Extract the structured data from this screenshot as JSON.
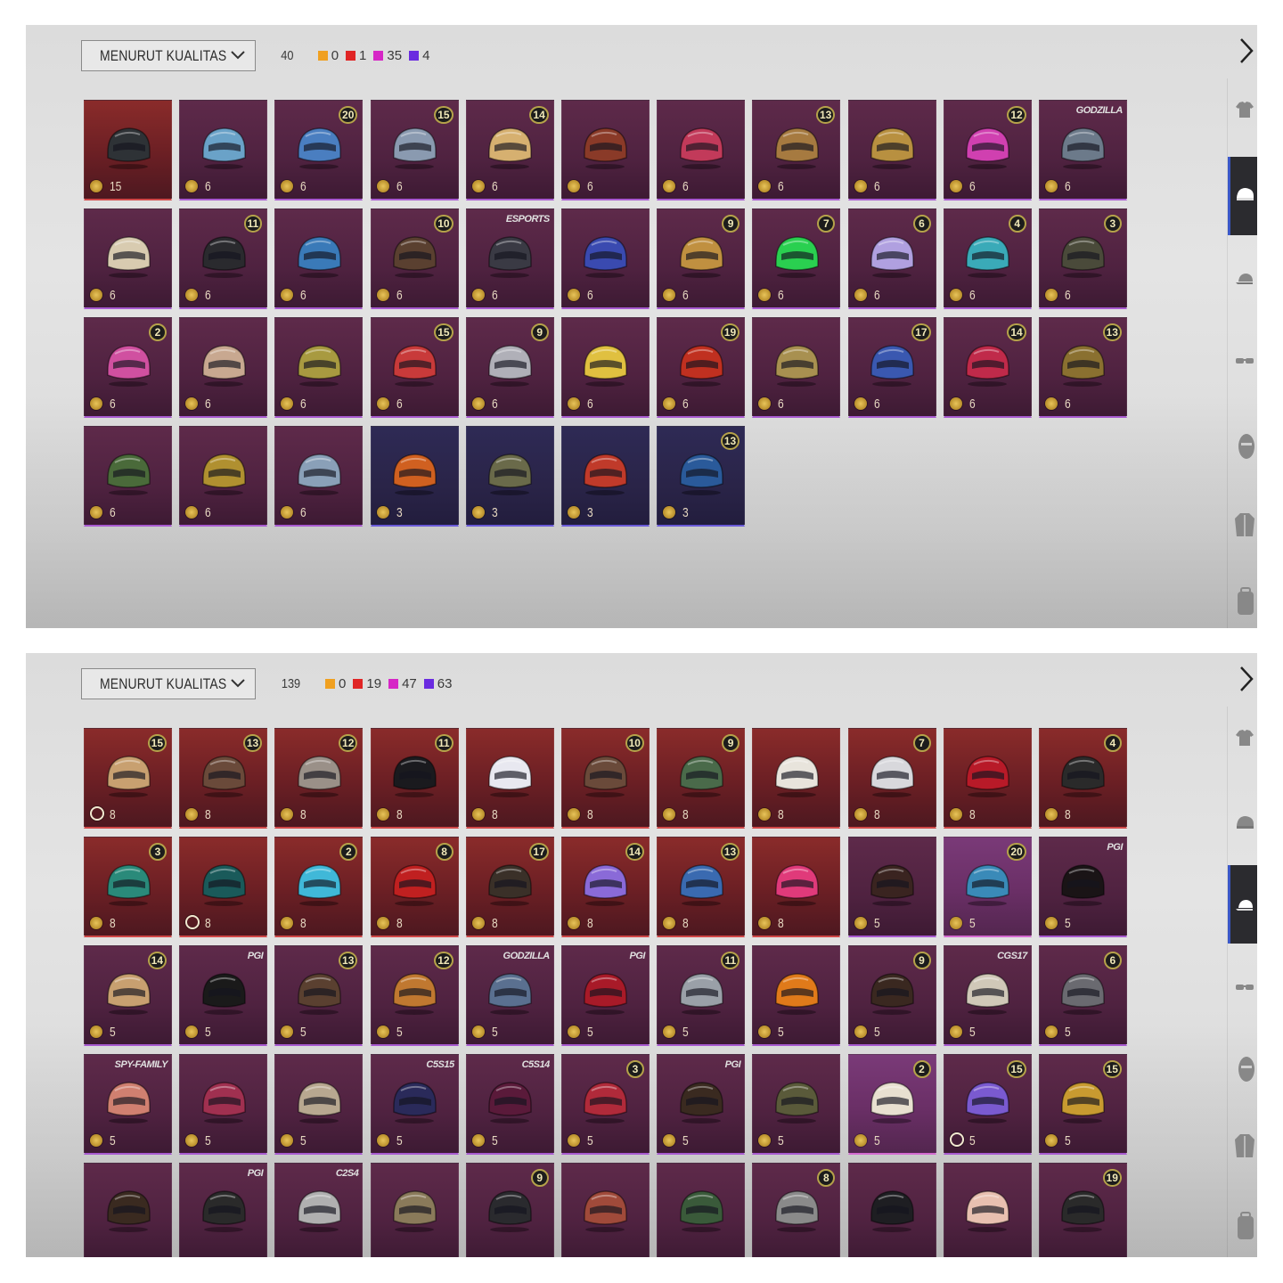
{
  "colors": {
    "orange": "#f0a020",
    "red": "#e02525",
    "pink": "#d626c6",
    "purple": "#6a2be0"
  },
  "panel_top": {
    "sort_label": "MENURUT KUALITAS",
    "total": "40",
    "counts": [
      {
        "color": "#f0a020",
        "value": "0"
      },
      {
        "color": "#e02525",
        "value": "1"
      },
      {
        "color": "#d626c6",
        "value": "35"
      },
      {
        "color": "#6a2be0",
        "value": "4"
      }
    ],
    "items": [
      {
        "tier": "red",
        "value": "15",
        "badge": "",
        "tag": "",
        "hue": "#2e3236"
      },
      {
        "tier": "purple",
        "value": "6",
        "badge": "",
        "tag": "",
        "hue": "#6aa2c8"
      },
      {
        "tier": "purple",
        "value": "6",
        "badge": "20",
        "tag": "",
        "hue": "#4a7ec0"
      },
      {
        "tier": "purple",
        "value": "6",
        "badge": "15",
        "tag": "",
        "hue": "#8a9ab0"
      },
      {
        "tier": "purple",
        "value": "6",
        "badge": "14",
        "tag": "",
        "hue": "#d6b070"
      },
      {
        "tier": "purple",
        "value": "6",
        "badge": "",
        "tag": "",
        "hue": "#8a3a28"
      },
      {
        "tier": "purple",
        "value": "6",
        "badge": "",
        "tag": "",
        "hue": "#c23a5a"
      },
      {
        "tier": "purple",
        "value": "6",
        "badge": "13",
        "tag": "",
        "hue": "#a67a40"
      },
      {
        "tier": "purple",
        "value": "6",
        "badge": "",
        "tag": "",
        "hue": "#b89040"
      },
      {
        "tier": "purple",
        "value": "6",
        "badge": "12",
        "tag": "",
        "hue": "#d040b0"
      },
      {
        "tier": "purple",
        "value": "6",
        "badge": "",
        "tag": "GODZILLA",
        "hue": "#6c7a8a"
      },
      {
        "tier": "purple",
        "value": "6",
        "badge": "",
        "tag": "",
        "hue": "#d8cbb0"
      },
      {
        "tier": "purple",
        "value": "6",
        "badge": "11",
        "tag": "",
        "hue": "#2a2a2e"
      },
      {
        "tier": "purple",
        "value": "6",
        "badge": "",
        "tag": "",
        "hue": "#3a7ab8"
      },
      {
        "tier": "purple",
        "value": "6",
        "badge": "10",
        "tag": "",
        "hue": "#5a4030"
      },
      {
        "tier": "purple",
        "value": "6",
        "badge": "",
        "tag": "ESPORTS",
        "hue": "#3a3a44"
      },
      {
        "tier": "purple",
        "value": "6",
        "badge": "",
        "tag": "",
        "hue": "#3a4ab0"
      },
      {
        "tier": "purple",
        "value": "6",
        "badge": "9",
        "tag": "",
        "hue": "#c09040"
      },
      {
        "tier": "purple",
        "value": "6",
        "badge": "7",
        "tag": "",
        "hue": "#2ad050"
      },
      {
        "tier": "purple",
        "value": "6",
        "badge": "6",
        "tag": "",
        "hue": "#b0a0e0"
      },
      {
        "tier": "purple",
        "value": "6",
        "badge": "4",
        "tag": "",
        "hue": "#3aaab8"
      },
      {
        "tier": "purple",
        "value": "6",
        "badge": "3",
        "tag": "",
        "hue": "#4a4a3a"
      },
      {
        "tier": "purple",
        "value": "6",
        "badge": "2",
        "tag": "",
        "hue": "#d050a0"
      },
      {
        "tier": "purple",
        "value": "6",
        "badge": "",
        "tag": "",
        "hue": "#c8a890"
      },
      {
        "tier": "purple",
        "value": "6",
        "badge": "",
        "tag": "",
        "hue": "#a89a40"
      },
      {
        "tier": "purple",
        "value": "6",
        "badge": "15",
        "tag": "",
        "hue": "#c83a3a"
      },
      {
        "tier": "purple",
        "value": "6",
        "badge": "9",
        "tag": "",
        "hue": "#b0b0b8"
      },
      {
        "tier": "purple",
        "value": "6",
        "badge": "",
        "tag": "",
        "hue": "#e0c040"
      },
      {
        "tier": "purple",
        "value": "6",
        "badge": "19",
        "tag": "",
        "hue": "#c03020"
      },
      {
        "tier": "purple",
        "value": "6",
        "badge": "",
        "tag": "",
        "hue": "#a89050"
      },
      {
        "tier": "purple",
        "value": "6",
        "badge": "17",
        "tag": "",
        "hue": "#3a58b0"
      },
      {
        "tier": "purple",
        "value": "6",
        "badge": "14",
        "tag": "",
        "hue": "#c02a4a"
      },
      {
        "tier": "purple",
        "value": "6",
        "badge": "13",
        "tag": "",
        "hue": "#8a7030"
      },
      {
        "tier": "purple",
        "value": "6",
        "badge": "",
        "tag": "",
        "hue": "#4a6a3a"
      },
      {
        "tier": "purple",
        "value": "6",
        "badge": "",
        "tag": "",
        "hue": "#b09030"
      },
      {
        "tier": "purple",
        "value": "6",
        "badge": "",
        "tag": "",
        "hue": "#8aa0b8"
      },
      {
        "tier": "blue",
        "value": "3",
        "badge": "",
        "tag": "",
        "hue": "#d06020"
      },
      {
        "tier": "blue",
        "value": "3",
        "badge": "",
        "tag": "",
        "hue": "#6a6a4a"
      },
      {
        "tier": "blue",
        "value": "3",
        "badge": "",
        "tag": "",
        "hue": "#c03a2a"
      },
      {
        "tier": "blue",
        "value": "3",
        "badge": "13",
        "tag": "",
        "hue": "#2a5a9a"
      }
    ]
  },
  "panel_bottom": {
    "sort_label": "MENURUT KUALITAS",
    "total": "139",
    "counts": [
      {
        "color": "#f0a020",
        "value": "0"
      },
      {
        "color": "#e02525",
        "value": "19"
      },
      {
        "color": "#d626c6",
        "value": "47"
      },
      {
        "color": "#6a2be0",
        "value": "63"
      }
    ],
    "items": [
      {
        "tier": "red",
        "value": "8",
        "badge": "15",
        "tag": "",
        "hue": "#c8a070",
        "coin": "ring"
      },
      {
        "tier": "red",
        "value": "8",
        "badge": "13",
        "tag": "",
        "hue": "#6a4a3a",
        "coin": ""
      },
      {
        "tier": "red",
        "value": "8",
        "badge": "12",
        "tag": "",
        "hue": "#9a9088",
        "coin": ""
      },
      {
        "tier": "red",
        "value": "8",
        "badge": "11",
        "tag": "",
        "hue": "#1a1a1e",
        "coin": ""
      },
      {
        "tier": "red",
        "value": "8",
        "badge": "",
        "tag": "",
        "hue": "#e8e8f0",
        "coin": ""
      },
      {
        "tier": "red",
        "value": "8",
        "badge": "10",
        "tag": "",
        "hue": "#6a4a3a",
        "coin": ""
      },
      {
        "tier": "red",
        "value": "8",
        "badge": "9",
        "tag": "",
        "hue": "#4a6a4a",
        "coin": ""
      },
      {
        "tier": "red",
        "value": "8",
        "badge": "",
        "tag": "",
        "hue": "#e8e4dc",
        "coin": ""
      },
      {
        "tier": "red",
        "value": "8",
        "badge": "7",
        "tag": "",
        "hue": "#d8d8dc",
        "coin": ""
      },
      {
        "tier": "red",
        "value": "8",
        "badge": "",
        "tag": "",
        "hue": "#b81a28",
        "coin": ""
      },
      {
        "tier": "red",
        "value": "8",
        "badge": "4",
        "tag": "",
        "hue": "#2a2a2a",
        "coin": ""
      },
      {
        "tier": "red",
        "value": "8",
        "badge": "3",
        "tag": "",
        "hue": "#2a8a7a",
        "coin": ""
      },
      {
        "tier": "red",
        "value": "8",
        "badge": "",
        "tag": "",
        "hue": "#1a5a5a",
        "coin": "ring"
      },
      {
        "tier": "red",
        "value": "8",
        "badge": "2",
        "tag": "",
        "hue": "#40b8d8",
        "coin": ""
      },
      {
        "tier": "red",
        "value": "8",
        "badge": "8",
        "tag": "",
        "hue": "#c02020",
        "coin": ""
      },
      {
        "tier": "red",
        "value": "8",
        "badge": "17",
        "tag": "",
        "hue": "#3a3028",
        "coin": ""
      },
      {
        "tier": "red",
        "value": "8",
        "badge": "14",
        "tag": "",
        "hue": "#8a6ad8",
        "coin": ""
      },
      {
        "tier": "red",
        "value": "8",
        "badge": "13",
        "tag": "",
        "hue": "#3a6ab0",
        "coin": ""
      },
      {
        "tier": "red",
        "value": "8",
        "badge": "",
        "tag": "",
        "hue": "#e03a7a",
        "coin": ""
      },
      {
        "tier": "purple",
        "value": "5",
        "badge": "",
        "tag": "",
        "hue": "#3a2420",
        "coin": ""
      },
      {
        "tier": "pink",
        "value": "5",
        "badge": "20",
        "tag": "",
        "hue": "#3a8ab8",
        "coin": ""
      },
      {
        "tier": "purple",
        "value": "5",
        "badge": "",
        "tag": "PGI",
        "hue": "#1a1416",
        "coin": ""
      },
      {
        "tier": "purple",
        "value": "5",
        "badge": "14",
        "tag": "",
        "hue": "#c8a070",
        "coin": ""
      },
      {
        "tier": "purple",
        "value": "5",
        "badge": "",
        "tag": "PGI",
        "hue": "#1a1a1a",
        "coin": ""
      },
      {
        "tier": "purple",
        "value": "5",
        "badge": "13",
        "tag": "",
        "hue": "#5a4030",
        "coin": ""
      },
      {
        "tier": "purple",
        "value": "5",
        "badge": "12",
        "tag": "",
        "hue": "#c07830",
        "coin": ""
      },
      {
        "tier": "purple",
        "value": "5",
        "badge": "",
        "tag": "GODZILLA",
        "hue": "#5a7090",
        "coin": ""
      },
      {
        "tier": "purple",
        "value": "5",
        "badge": "",
        "tag": "PGI",
        "hue": "#a81a28",
        "coin": ""
      },
      {
        "tier": "purple",
        "value": "5",
        "badge": "11",
        "tag": "",
        "hue": "#9aa0a8",
        "coin": ""
      },
      {
        "tier": "purple",
        "value": "5",
        "badge": "",
        "tag": "",
        "hue": "#e07a1a",
        "coin": ""
      },
      {
        "tier": "purple",
        "value": "5",
        "badge": "9",
        "tag": "",
        "hue": "#3a2820",
        "coin": ""
      },
      {
        "tier": "purple",
        "value": "5",
        "badge": "",
        "tag": "CGS17",
        "hue": "#d0c8b8",
        "coin": ""
      },
      {
        "tier": "purple",
        "value": "5",
        "badge": "6",
        "tag": "",
        "hue": "#6a6a70",
        "coin": ""
      },
      {
        "tier": "purple",
        "value": "5",
        "badge": "",
        "tag": "SPY-FAMILY",
        "hue": "#d08070",
        "coin": ""
      },
      {
        "tier": "purple",
        "value": "5",
        "badge": "",
        "tag": "",
        "hue": "#a03050",
        "coin": ""
      },
      {
        "tier": "purple",
        "value": "5",
        "badge": "",
        "tag": "",
        "hue": "#b8a890",
        "coin": ""
      },
      {
        "tier": "purple",
        "value": "5",
        "badge": "",
        "tag": "C5S15",
        "hue": "#2a2a5a",
        "coin": ""
      },
      {
        "tier": "purple",
        "value": "5",
        "badge": "",
        "tag": "C5S14",
        "hue": "#5a1a3a",
        "coin": ""
      },
      {
        "tier": "purple",
        "value": "5",
        "badge": "3",
        "tag": "",
        "hue": "#b02a3a",
        "coin": ""
      },
      {
        "tier": "purple",
        "value": "5",
        "badge": "",
        "tag": "PGI",
        "hue": "#3a2a20",
        "coin": ""
      },
      {
        "tier": "purple",
        "value": "5",
        "badge": "",
        "tag": "",
        "hue": "#5a5a3a",
        "coin": ""
      },
      {
        "tier": "pink",
        "value": "5",
        "badge": "2",
        "tag": "",
        "hue": "#e8e0d0",
        "coin": ""
      },
      {
        "tier": "purple",
        "value": "5",
        "badge": "15",
        "tag": "",
        "hue": "#7a5ad0",
        "coin": "ring"
      },
      {
        "tier": "purple",
        "value": "5",
        "badge": "15",
        "tag": "",
        "hue": "#c89a30",
        "coin": ""
      },
      {
        "tier": "purple",
        "value": "",
        "badge": "",
        "tag": "",
        "hue": "#3a2a20",
        "coin": ""
      },
      {
        "tier": "purple",
        "value": "",
        "badge": "",
        "tag": "PGI",
        "hue": "#2a2a2a",
        "coin": ""
      },
      {
        "tier": "purple",
        "value": "",
        "badge": "",
        "tag": "C2S4",
        "hue": "#b0b0b0",
        "coin": ""
      },
      {
        "tier": "purple",
        "value": "",
        "badge": "",
        "tag": "",
        "hue": "#8a7a5a",
        "coin": ""
      },
      {
        "tier": "purple",
        "value": "",
        "badge": "9",
        "tag": "",
        "hue": "#2a2a2e",
        "coin": ""
      },
      {
        "tier": "purple",
        "value": "",
        "badge": "",
        "tag": "",
        "hue": "#a04a3a",
        "coin": ""
      },
      {
        "tier": "purple",
        "value": "",
        "badge": "",
        "tag": "",
        "hue": "#3a5a3a",
        "coin": ""
      },
      {
        "tier": "purple",
        "value": "",
        "badge": "8",
        "tag": "",
        "hue": "#8a8a8a",
        "coin": ""
      },
      {
        "tier": "purple",
        "value": "",
        "badge": "",
        "tag": "",
        "hue": "#1e1e22",
        "coin": ""
      },
      {
        "tier": "purple",
        "value": "",
        "badge": "",
        "tag": "",
        "hue": "#e8c0b0",
        "coin": ""
      },
      {
        "tier": "purple",
        "value": "",
        "badge": "19",
        "tag": "",
        "hue": "#2a2a2a",
        "coin": ""
      }
    ]
  },
  "rail_icons": [
    "shirt-icon",
    "helmet-icon",
    "cap-icon",
    "glasses-icon",
    "mask-icon",
    "jacket-icon",
    "backpack-icon"
  ]
}
